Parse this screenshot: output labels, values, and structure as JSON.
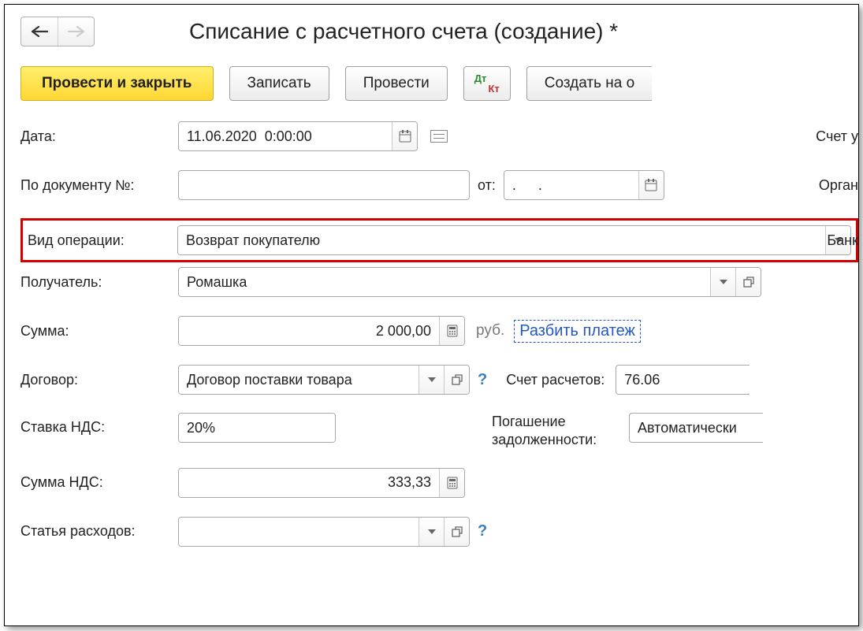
{
  "header": {
    "title": "Списание с расчетного счета (создание) *"
  },
  "nav": {
    "back": "←",
    "forward": "→"
  },
  "toolbar": {
    "post_and_close": "Провести и закрыть",
    "save": "Записать",
    "post": "Провести",
    "dtkt_dt": "Дт",
    "dtkt_kt": "Кт",
    "create_based": "Создать на о"
  },
  "labels": {
    "date": "Дата:",
    "by_doc": "По документу №:",
    "ot": "от:",
    "op_type": "Вид операции:",
    "recipient": "Получатель:",
    "sum": "Сумма:",
    "contract": "Договор:",
    "settlement_account": "Счет расчетов:",
    "vat_rate": "Ставка НДС:",
    "debt_repay": "Погашение задолженности:",
    "vat_sum": "Сумма НДС:",
    "expense_item": "Статья расходов:",
    "account": "Счет у",
    "organization": "Орган",
    "bank": "Банк"
  },
  "fields": {
    "date": "11.06.2020  0:00:00",
    "doc_no": "",
    "doc_date": ".  .",
    "op_type": "Возврат покупателю",
    "recipient": "Ромашка",
    "sum": "2 000,00",
    "rub": "руб.",
    "split_link": "Разбить платеж",
    "contract": "Договор поставки товара",
    "settlement_account": "76.06",
    "vat_rate": "20%",
    "debt_repay": "Автоматически",
    "vat_sum": "333,33",
    "expense_item": ""
  },
  "icons": {
    "dropdown": "▼",
    "open": "▫",
    "calc": "▦",
    "calendar": "▥"
  }
}
